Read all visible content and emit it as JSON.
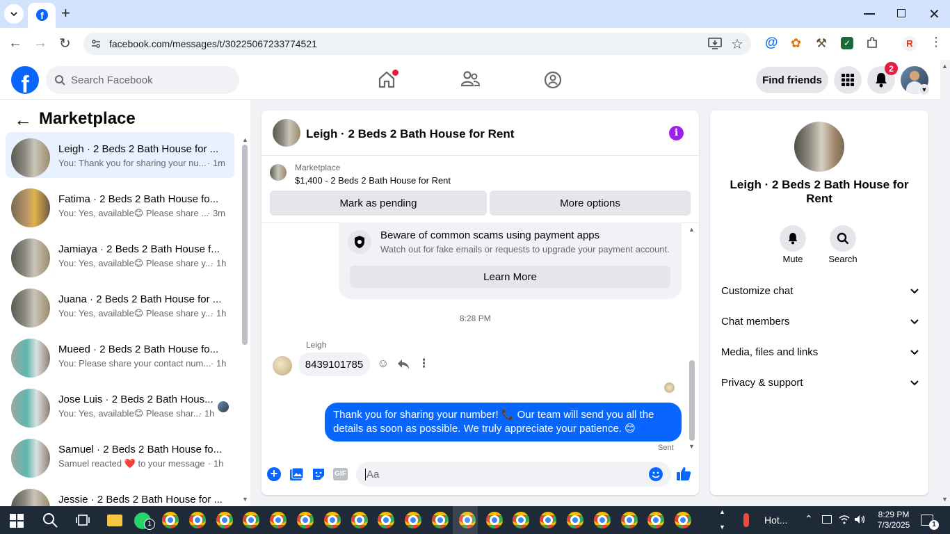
{
  "browser": {
    "url": "facebook.com/messages/t/30225067233774521",
    "extension_badge": "R"
  },
  "fb": {
    "search_placeholder": "Search Facebook",
    "find_friends": "Find friends",
    "notifications_count": "2"
  },
  "sidebar": {
    "title": "Marketplace",
    "conversations": [
      {
        "name": "Leigh · 2 Beds 2 Bath House for ...",
        "preview": "You: Thank you for sharing your nu...",
        "time": "· 1m",
        "active": true
      },
      {
        "name": "Fatima · 2 Beds 2 Bath House fo...",
        "preview": "You: Yes, available😊 Please share ...",
        "time": "· 3m"
      },
      {
        "name": "Jamiaya · 2 Beds 2 Bath House f...",
        "preview": "You: Yes, available😊 Please share y...",
        "time": "· 1h"
      },
      {
        "name": "Juana · 2 Beds 2 Bath House for ...",
        "preview": "You: Yes, available😊 Please share y...",
        "time": "· 1h"
      },
      {
        "name": "Mueed · 2 Beds 2 Bath House fo...",
        "preview": "You: Please share your contact num...",
        "time": "· 1h"
      },
      {
        "name": "Jose Luis · 2 Beds 2 Bath Hous...",
        "preview": "You: Yes, available😊 Please shar...",
        "time": "· 1h"
      },
      {
        "name": "Samuel · 2 Beds 2 Bath House fo...",
        "preview": "Samuel reacted ❤️ to your message",
        "time": "· 1h"
      },
      {
        "name": "Jessie · 2 Beds 2 Bath House for ...",
        "preview": "",
        "time": ""
      }
    ]
  },
  "chat": {
    "title": "Leigh · 2 Beds 2 Bath House for Rent",
    "listing_source": "Marketplace",
    "listing_line": "$1,400 - 2 Beds 2 Bath House for Rent",
    "mark_pending": "Mark as pending",
    "more_options": "More options",
    "scam_title": "Beware of common scams using payment apps",
    "scam_body": "Watch out for fake emails or requests to upgrade your payment account.",
    "learn_more": "Learn More",
    "timestamp": "8:28 PM",
    "sender_name": "Leigh",
    "incoming_text": "8439101785",
    "outgoing_line1": "Thank you for sharing your number! 📞 Our team will send you all the",
    "outgoing_line2": "details as soon as possible. We truly appreciate your patience. 😊",
    "sent_status": "Sent",
    "composer_placeholder": "Aa",
    "gif_label": "GIF"
  },
  "info": {
    "name": "Leigh · 2 Beds 2 Bath House for Rent",
    "mute": "Mute",
    "search": "Search",
    "sections": [
      "Customize chat",
      "Chat members",
      "Media, files and links",
      "Privacy & support"
    ]
  },
  "taskbar": {
    "weather": "Hot...",
    "time": "8:29 PM",
    "date": "7/3/2025",
    "notif_count": "1",
    "whatsapp_badge": "1"
  },
  "colors": {
    "fb_blue": "#0866ff",
    "badge_red": "#e41e3f",
    "info_purple": "#a020f0"
  }
}
